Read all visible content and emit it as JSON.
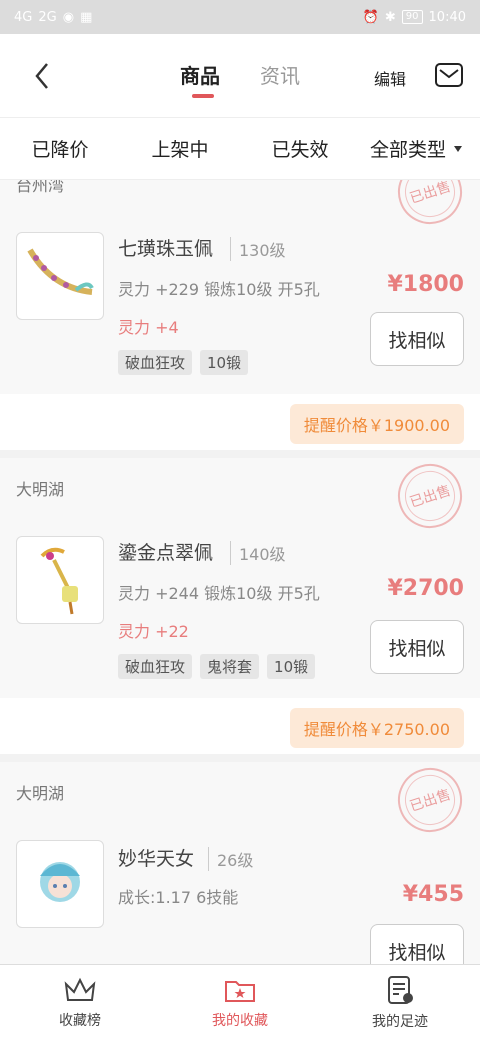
{
  "status": {
    "left_signal_a": "4G",
    "left_signal_b": "2G",
    "battery": "90",
    "time": "10:40"
  },
  "header": {
    "tabs": [
      {
        "label": "商品",
        "active": true
      },
      {
        "label": "资讯",
        "active": false
      }
    ],
    "edit_label": "编辑"
  },
  "filters": [
    "已降价",
    "上架中",
    "已失效",
    "全部类型"
  ],
  "items": [
    {
      "seller": "台州湾",
      "stamp": "已出售",
      "name": "七璜珠玉佩",
      "level": "130级",
      "attr": "灵力 +229 锻炼10级 开5孔",
      "bonus": "灵力 +4",
      "tags": [
        "破血狂攻",
        "10锻"
      ],
      "price": "¥1800",
      "similar": "找相似",
      "remind": "提醒价格￥1900.00"
    },
    {
      "seller": "大明湖",
      "stamp": "已出售",
      "name": "鎏金点翠佩",
      "level": "140级",
      "attr": "灵力 +244 锻炼10级 开5孔",
      "bonus": "灵力 +22",
      "tags": [
        "破血狂攻",
        "鬼将套",
        "10锻"
      ],
      "price": "¥2700",
      "similar": "找相似",
      "remind": "提醒价格￥2750.00"
    },
    {
      "seller": "大明湖",
      "stamp": "已出售",
      "name": "妙华天女",
      "level": "26级",
      "attr": "成长:1.17 6技能",
      "price": "¥455",
      "similar": "找相似"
    }
  ],
  "nav": [
    {
      "label": "收藏榜",
      "icon": "crown-icon"
    },
    {
      "label": "我的收藏",
      "icon": "folder-star-icon",
      "active": true
    },
    {
      "label": "我的足迹",
      "icon": "history-icon"
    }
  ],
  "colors": {
    "accent": "#e0575a",
    "price": "#e87d7d",
    "remind_bg": "#fde9d7",
    "remind_text": "#f08b3a"
  }
}
